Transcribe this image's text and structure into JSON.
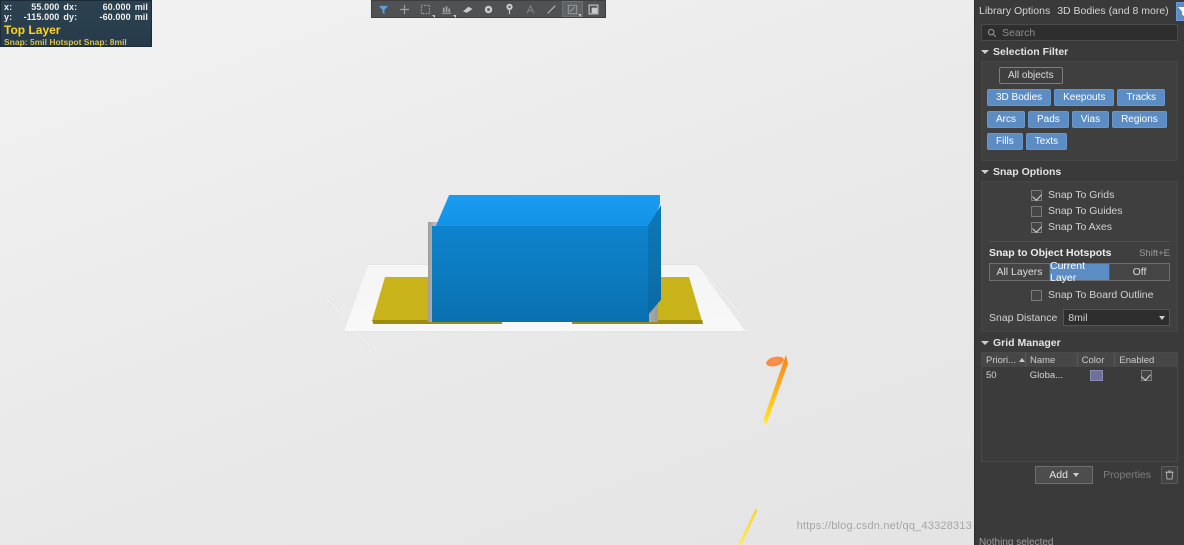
{
  "hud": {
    "x_key": "x:",
    "x_val": "55.000",
    "dx_key": "dx:",
    "dx_val": "60.000",
    "dx_unit": "mil",
    "y_key": "y:",
    "y_val": "-115.000",
    "dy_key": "dy:",
    "dy_val": "-60.000",
    "dy_unit": "mil",
    "layer": "Top Layer",
    "snap": "Snap: 5mil Hotspot Snap: 8mil"
  },
  "toolbar": {
    "items": [
      {
        "name": "filter-funnel-icon",
        "selected": false
      },
      {
        "name": "crosshair-icon",
        "selected": false
      },
      {
        "name": "marquee-select-icon",
        "selected": false
      },
      {
        "name": "align-icon",
        "selected": false
      },
      {
        "name": "eraser-icon",
        "selected": false
      },
      {
        "name": "via-icon",
        "selected": false
      },
      {
        "name": "pad-pin-icon",
        "selected": false
      },
      {
        "name": "text-icon",
        "selected": false
      },
      {
        "name": "line-icon",
        "selected": false
      },
      {
        "name": "dimension-icon",
        "selected": true
      },
      {
        "name": "layer-stack-icon",
        "selected": false
      }
    ]
  },
  "panel": {
    "header": {
      "library_options": "Library Options",
      "bodies_tab": "3D Bodies (and 8 more)",
      "filter_icon": "filter-funnel-icon",
      "dropdown_icon": "chevron-down-icon"
    },
    "search": {
      "value": "",
      "placeholder": "Search",
      "icon": "search-icon"
    },
    "selection_filter": {
      "title": "Selection Filter",
      "all_objects": "All objects",
      "chips": [
        "3D Bodies",
        "Keepouts",
        "Tracks",
        "Arcs",
        "Pads",
        "Vias",
        "Regions",
        "Fills",
        "Texts"
      ]
    },
    "snap_options": {
      "title": "Snap Options",
      "checkboxes": [
        {
          "label": "Snap To Grids",
          "checked": true
        },
        {
          "label": "Snap To Guides",
          "checked": false
        },
        {
          "label": "Snap To Axes",
          "checked": true
        }
      ],
      "hotspots_title": "Snap to Object Hotspots",
      "hotspots_shortcut": "Shift+E",
      "hotspot_segments": [
        "All Layers",
        "Current Layer",
        "Off"
      ],
      "hotspot_active": "Current Layer",
      "board_outline": {
        "label": "Snap To Board Outline",
        "checked": false
      },
      "snap_distance_label": "Snap Distance",
      "snap_distance_value": "8mil"
    },
    "grid_manager": {
      "title": "Grid Manager",
      "columns": [
        "Priori...",
        "Name",
        "Color",
        "Enabled"
      ],
      "sort_column": "Priori...",
      "rows": [
        {
          "priority": "50",
          "name": "Globa...",
          "color": "#6f6f9a",
          "enabled": true
        }
      ],
      "add_label": "Add",
      "properties_label": "Properties",
      "delete_icon": "trash-icon"
    },
    "status": "Nothing selected"
  },
  "canvas": {
    "watermark": "https://blog.csdn.net/qq_43328313",
    "colors": {
      "component_body_front": "#0f7ec4",
      "component_body_top": "#1292e8",
      "component_body_side": "#0b6ba8",
      "terminal": "#a8a8a8",
      "pad_gold": "#c8b41a",
      "cone_orange": "#f7941e",
      "cone_yellow": "#ffdd17",
      "background": "#ebebeb"
    }
  }
}
